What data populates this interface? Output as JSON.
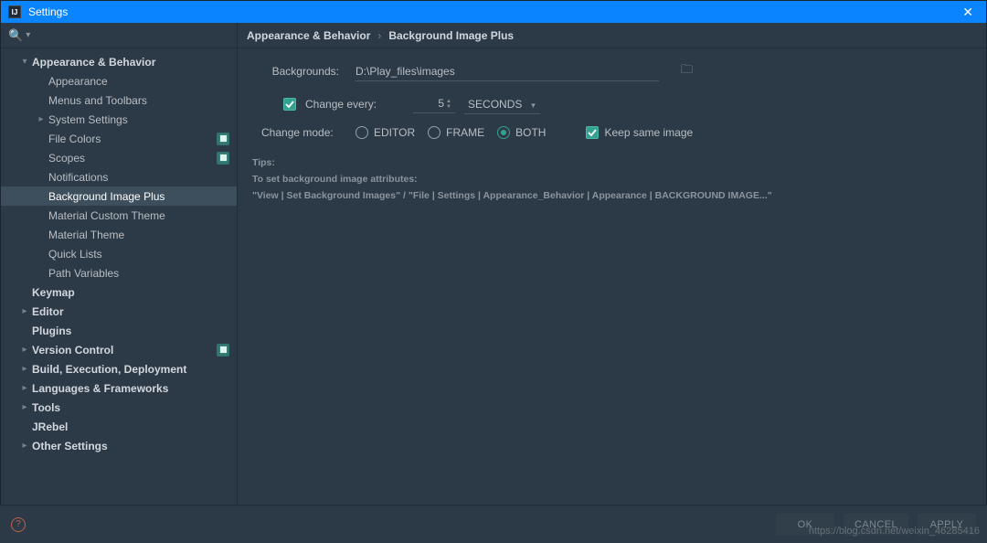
{
  "window": {
    "title": "Settings"
  },
  "breadcrumb": {
    "parent": "Appearance & Behavior",
    "child": "Background Image Plus"
  },
  "sidebar": {
    "items": [
      {
        "label": "Appearance & Behavior",
        "indent": 1,
        "bold": true,
        "arrow": "down"
      },
      {
        "label": "Appearance",
        "indent": 2
      },
      {
        "label": "Menus and Toolbars",
        "indent": 2
      },
      {
        "label": "System Settings",
        "indent": 2,
        "arrow": "right"
      },
      {
        "label": "File Colors",
        "indent": 2,
        "badge": true
      },
      {
        "label": "Scopes",
        "indent": 2,
        "badge": true
      },
      {
        "label": "Notifications",
        "indent": 2
      },
      {
        "label": "Background Image Plus",
        "indent": 2,
        "selected": true
      },
      {
        "label": "Material Custom Theme",
        "indent": 2
      },
      {
        "label": "Material Theme",
        "indent": 2
      },
      {
        "label": "Quick Lists",
        "indent": 2
      },
      {
        "label": "Path Variables",
        "indent": 2
      },
      {
        "label": "Keymap",
        "indent": 1,
        "bold": true
      },
      {
        "label": "Editor",
        "indent": 1,
        "bold": true,
        "arrow": "right"
      },
      {
        "label": "Plugins",
        "indent": 1,
        "bold": true
      },
      {
        "label": "Version Control",
        "indent": 1,
        "bold": true,
        "arrow": "right",
        "badge": true
      },
      {
        "label": "Build, Execution, Deployment",
        "indent": 1,
        "bold": true,
        "arrow": "right"
      },
      {
        "label": "Languages & Frameworks",
        "indent": 1,
        "bold": true,
        "arrow": "right"
      },
      {
        "label": "Tools",
        "indent": 1,
        "bold": true,
        "arrow": "right"
      },
      {
        "label": "JRebel",
        "indent": 1,
        "bold": true
      },
      {
        "label": "Other Settings",
        "indent": 1,
        "bold": true,
        "arrow": "right"
      }
    ]
  },
  "form": {
    "backgrounds_label": "Backgrounds:",
    "backgrounds_value": "D:\\Play_files\\images",
    "change_every_label": "Change every:",
    "change_every_value": "5",
    "change_every_unit": "SECONDS",
    "change_mode_label": "Change mode:",
    "mode_editor": "EDITOR",
    "mode_frame": "FRAME",
    "mode_both": "BOTH",
    "keep_same_label": "Keep same image"
  },
  "tips": {
    "title": "Tips:",
    "body1": "To set background image attributes:",
    "body2": "\"View | Set Background Images\" / \"File | Settings | Appearance_Behavior | Appearance | BACKGROUND IMAGE...\""
  },
  "footer": {
    "ok": "OK",
    "cancel": "CANCEL",
    "apply": "APPLY"
  },
  "watermark": "https://blog.csdn.net/weixin_46285416"
}
